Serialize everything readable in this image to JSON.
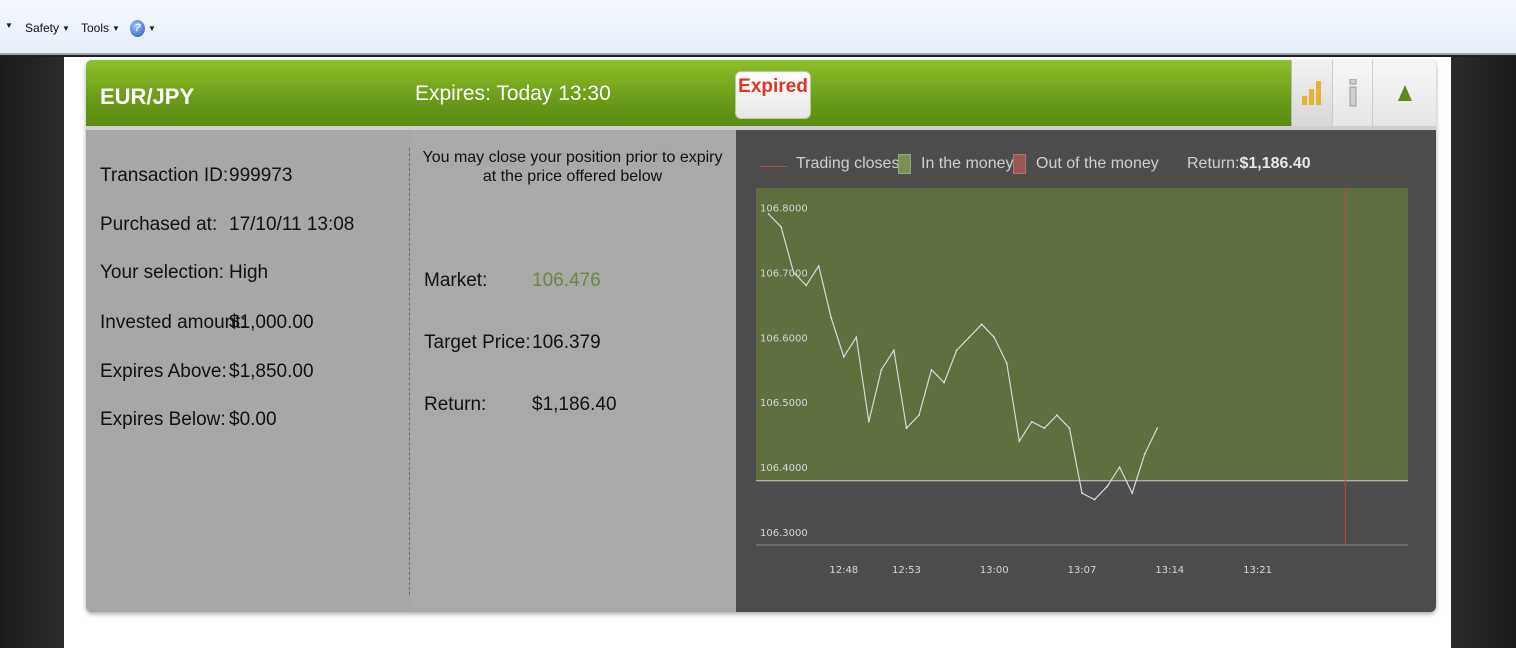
{
  "browser": {
    "menu": [
      {
        "label": "Safety"
      },
      {
        "label": "Tools"
      }
    ],
    "help_icon": "help-icon"
  },
  "widget": {
    "pair": "EUR/JPY",
    "expires_label": "Expires:",
    "expires_value": "Today 13:30",
    "status_badge": "Expired",
    "toolbar_icons": [
      "bar-chart-icon",
      "info-icon",
      "collapse-up-icon"
    ],
    "colors": {
      "header_green": "#6d9e1a",
      "expired_red": "#e03526",
      "market_green": "#6b8a3e",
      "in_money": "#5f6f3e",
      "out_money": "#9b5756",
      "trading_closes_line": "#b94b45"
    }
  },
  "details": [
    {
      "label": "Transaction ID:",
      "value": "999973"
    },
    {
      "label": "Purchased at:",
      "value": "17/10/11 13:08"
    },
    {
      "label": "Your selection:",
      "value": "High"
    },
    {
      "label": "Invested amount:",
      "value": "$1,000.00"
    },
    {
      "label": "Expires Above:",
      "value": "$1,850.00"
    },
    {
      "label": "Expires Below:",
      "value": "$0.00"
    }
  ],
  "position": {
    "note": "You may close your position prior to expiry at the price offered below",
    "market_label": "Market:",
    "market_value": "106.476",
    "target_label": "Target Price:",
    "target_value": "106.379",
    "return_label": "Return:",
    "return_value": "$1,186.40"
  },
  "legend": {
    "trading_closes": "Trading closes",
    "in_money": "In the money",
    "out_money": "Out of the money",
    "return_label": "Return:",
    "return_value": "$1,186.40"
  },
  "chart_data": {
    "type": "line",
    "y_ticks": [
      "106.8000",
      "106.7000",
      "106.6000",
      "106.5000",
      "106.4000",
      "106.3000"
    ],
    "x_ticks": [
      "12:48",
      "12:53",
      "13:00",
      "13:07",
      "13:14",
      "13:21"
    ],
    "ylim": [
      106.28,
      106.83
    ],
    "in_money_threshold": 106.379,
    "trading_closes_at": "13:28",
    "series": [
      {
        "x": [
          "12:42",
          "12:43",
          "12:44",
          "12:45",
          "12:46",
          "12:47",
          "12:48",
          "12:49",
          "12:50",
          "12:51",
          "12:52",
          "12:53",
          "12:54",
          "12:55",
          "12:56",
          "12:57",
          "12:58",
          "12:59",
          "13:00",
          "13:01",
          "13:02",
          "13:03",
          "13:04",
          "13:05",
          "13:06",
          "13:07",
          "13:08",
          "13:09",
          "13:10",
          "13:11",
          "13:12",
          "13:13"
        ],
        "values": [
          106.79,
          106.77,
          106.7,
          106.68,
          106.71,
          106.63,
          106.57,
          106.6,
          106.47,
          106.55,
          106.58,
          106.46,
          106.48,
          106.55,
          106.53,
          106.58,
          106.6,
          106.62,
          106.6,
          106.56,
          106.44,
          106.47,
          106.46,
          106.48,
          106.46,
          106.36,
          106.35,
          106.37,
          106.4,
          106.36,
          106.42,
          106.46
        ]
      }
    ]
  }
}
